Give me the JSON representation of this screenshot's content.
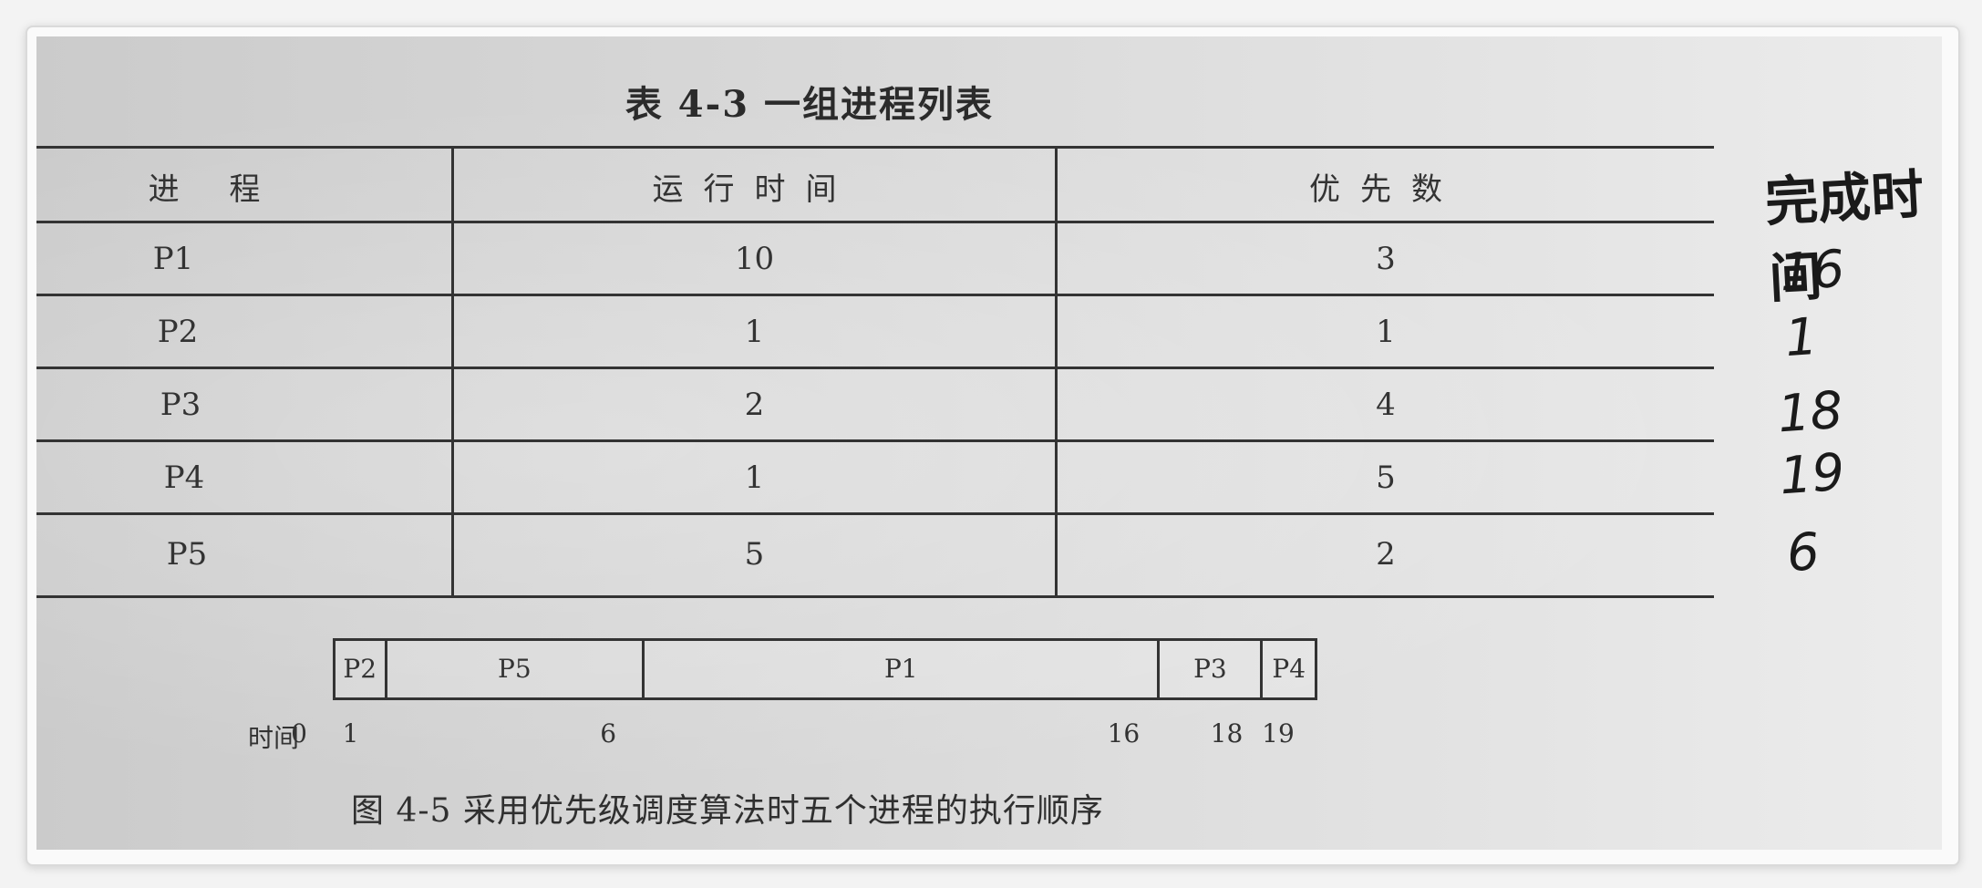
{
  "table_title": "表 4-3   一组进程列表",
  "table": {
    "headers": [
      "进  程",
      "运行时间",
      "优先数"
    ],
    "rows": [
      [
        "P1",
        "10",
        "3"
      ],
      [
        "P2",
        "1",
        "1"
      ],
      [
        "P3",
        "2",
        "4"
      ],
      [
        "P4",
        "1",
        "5"
      ],
      [
        "P5",
        "5",
        "2"
      ]
    ]
  },
  "handwritten": {
    "header": "完成时间",
    "values": [
      "16",
      "1",
      "18",
      "19",
      "6"
    ]
  },
  "gantt": {
    "time_label": "时间",
    "segments": [
      {
        "label": "P2",
        "start": 0,
        "end": 1
      },
      {
        "label": "P5",
        "start": 1,
        "end": 6
      },
      {
        "label": "P1",
        "start": 6,
        "end": 16
      },
      {
        "label": "P3",
        "start": 16,
        "end": 18
      },
      {
        "label": "P4",
        "start": 18,
        "end": 19
      }
    ],
    "ticks": [
      "0",
      "1",
      "6",
      "16",
      "18",
      "19"
    ]
  },
  "caption": "图 4-5   采用优先级调度算法时五个进程的执行顺序"
}
